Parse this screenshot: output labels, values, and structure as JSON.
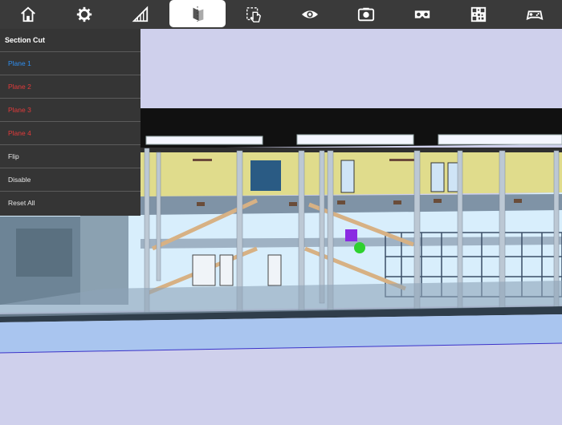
{
  "toolbar": {
    "buttons": [
      {
        "icon": "home-icon"
      },
      {
        "icon": "gear-icon"
      },
      {
        "icon": "ruler-icon"
      },
      {
        "icon": "section-cut-icon",
        "active": true
      },
      {
        "icon": "tap-hand-icon"
      },
      {
        "icon": "eye-icon"
      },
      {
        "icon": "camera-icon"
      },
      {
        "icon": "vr-headset-icon"
      },
      {
        "icon": "qr-code-icon"
      },
      {
        "icon": "gamepad-icon"
      }
    ]
  },
  "section_menu": {
    "title": "Section Cut",
    "items": [
      {
        "label": "Plane 1",
        "color": "#2f8ff0"
      },
      {
        "label": "Plane 2",
        "color": "#e23b3b"
      },
      {
        "label": "Plane 3",
        "color": "#e23b3b"
      },
      {
        "label": "Plane 4",
        "color": "#e23b3b"
      },
      {
        "label": "Flip"
      },
      {
        "label": "Disable"
      },
      {
        "label": "Reset All"
      }
    ]
  },
  "colors": {
    "toolbar_bg": "#3a3a3a",
    "menu_bg": "#353535",
    "sky": "#cfd0ec",
    "wall_yellow": "#e0dc8c",
    "floor_blue": "#a9c5ef",
    "marker_purple": "#8a2be2",
    "marker_green": "#2ed12e"
  }
}
